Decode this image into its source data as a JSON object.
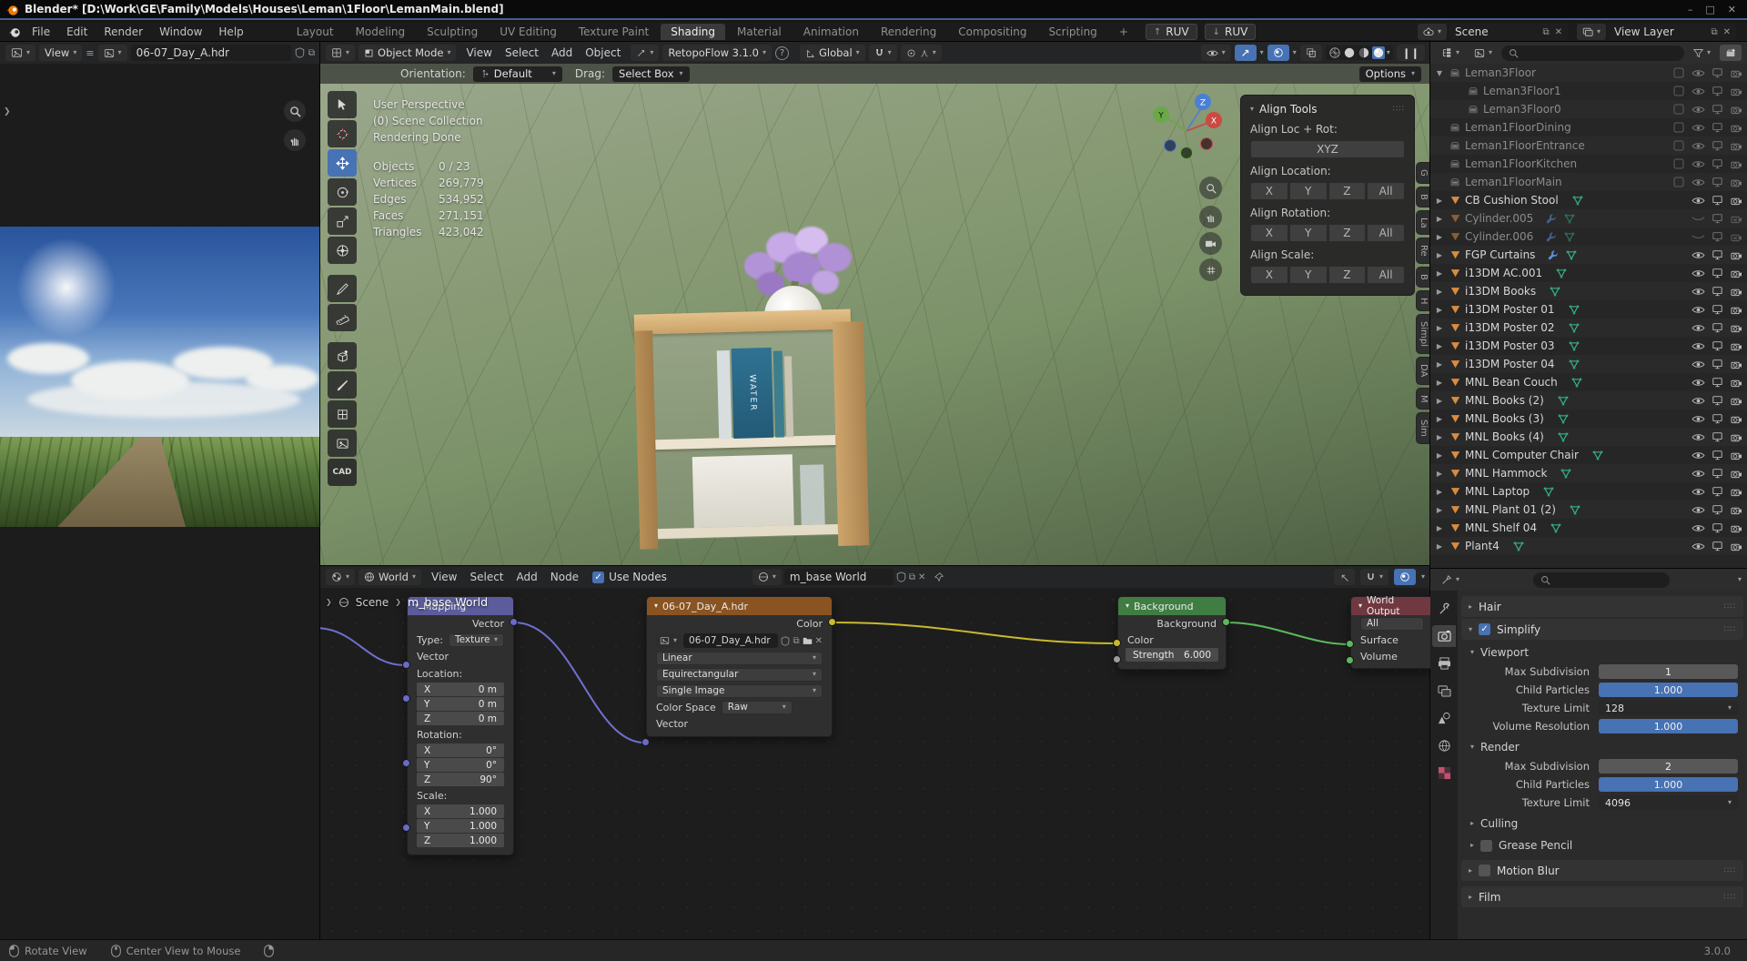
{
  "colors": {
    "accent": "#4772b3",
    "wire_yellow": "#c9b92e",
    "wire_green": "#5cb85c",
    "wire_purple": "#7070cf",
    "node_mapping": "#5c5c9c",
    "node_texture": "#8a5322",
    "node_background": "#3f7d43",
    "node_output": "#703841",
    "mesh_icon": "#d98c3f",
    "data_icon": "#3fbf8f",
    "wrench_icon": "#5b8fe0"
  },
  "titlebar": {
    "title": "Blender* [D:\\Work\\GE\\Family\\Models\\Houses\\Leman\\1Floor\\LemanMain.blend]",
    "controls": [
      "–",
      "□",
      "✕"
    ]
  },
  "menubar": {
    "menus": [
      "File",
      "Edit",
      "Render",
      "Window",
      "Help"
    ],
    "tabs": [
      "Layout",
      "Modeling",
      "Sculpting",
      "UV Editing",
      "Texture Paint",
      "Shading",
      "Material",
      "Animation",
      "Rendering",
      "Compositing",
      "Scripting"
    ],
    "active_tab": "Shading",
    "add_tab": "+",
    "ruv_buttons": [
      {
        "icon": "up",
        "label": "RUV"
      },
      {
        "icon": "down",
        "label": "RUV"
      }
    ],
    "scene_selector": "Scene",
    "view_layer_selector": "View Layer"
  },
  "image_editor": {
    "menu_view": "View",
    "image_name": "06-07_Day_A.hdr"
  },
  "viewport": {
    "header": {
      "mode": "Object Mode",
      "menus": [
        "View",
        "Select",
        "Add",
        "Object"
      ],
      "addon_dropdown": "RetopoFlow 3.1.0",
      "orientation": "Global"
    },
    "tool_settings": {
      "orientation_label": "Orientation:",
      "orientation_value": "Default",
      "drag_label": "Drag:",
      "drag_value": "Select Box",
      "options_label": "Options"
    },
    "overlay_lines": [
      "User Perspective",
      "(0) Scene Collection",
      "Rendering Done"
    ],
    "stats": [
      {
        "label": "Objects",
        "value": "0 / 23"
      },
      {
        "label": "Vertices",
        "value": "269,779"
      },
      {
        "label": "Edges",
        "value": "534,952"
      },
      {
        "label": "Faces",
        "value": "271,151"
      },
      {
        "label": "Triangles",
        "value": "423,042"
      }
    ],
    "toolbar_tools": [
      "select-box",
      "cursor",
      "move",
      "rotate",
      "scale",
      "transform",
      "annotate",
      "measure",
      "add-cube",
      "brush",
      "fill",
      "image"
    ],
    "toolbar_active": "move",
    "cad_label": "CAD",
    "axis_gizmo": {
      "x": "X",
      "y": "Y",
      "z": "Z"
    },
    "sidebar_tabs": [
      "G",
      "B",
      "La",
      "Re",
      "B",
      "H",
      "Simpl",
      "DA",
      "M",
      "Sim"
    ],
    "book_label": "WATER",
    "align_tools": {
      "title": "Align Tools",
      "loc_rot_label": "Align Loc + Rot:",
      "loc_rot_button": "XYZ",
      "groups": [
        {
          "label": "Align Location:",
          "buttons": [
            "X",
            "Y",
            "Z",
            "All"
          ]
        },
        {
          "label": "Align Rotation:",
          "buttons": [
            "X",
            "Y",
            "Z",
            "All"
          ]
        },
        {
          "label": "Align Scale:",
          "buttons": [
            "X",
            "Y",
            "Z",
            "All"
          ]
        }
      ]
    }
  },
  "outliner": {
    "rows": [
      {
        "label": "Leman3Floor",
        "icon": "collection",
        "indent": 0,
        "dim": true,
        "expand": "down",
        "right": "collection"
      },
      {
        "label": "Leman3Floor1",
        "icon": "collection",
        "indent": 1,
        "dim": true,
        "right": "collection"
      },
      {
        "label": "Leman3Floor0",
        "icon": "collection",
        "indent": 1,
        "dim": true,
        "right": "collection"
      },
      {
        "label": "Leman1FloorDining",
        "icon": "collection",
        "indent": 0,
        "dim": true,
        "right": "collection"
      },
      {
        "label": "Leman1FloorEntrance",
        "icon": "collection",
        "indent": 0,
        "dim": true,
        "right": "collection"
      },
      {
        "label": "Leman1FloorKitchen",
        "icon": "collection",
        "indent": 0,
        "dim": true,
        "right": "collection"
      },
      {
        "label": "Leman1FloorMain",
        "icon": "collection",
        "indent": 0,
        "dim": true,
        "right": "collection"
      },
      {
        "label": "CB Cushion Stool",
        "icon": "mesh",
        "indent": 0,
        "expand": "right",
        "data": true,
        "right": "object"
      },
      {
        "label": "Cylinder.005",
        "icon": "mesh",
        "indent": 0,
        "dim": true,
        "expand": "right",
        "wrench": true,
        "data": true,
        "right": "object-hidden"
      },
      {
        "label": "Cylinder.006",
        "icon": "mesh",
        "indent": 0,
        "dim": true,
        "expand": "right",
        "wrench": true,
        "data": true,
        "right": "object-hidden"
      },
      {
        "label": "FGP Curtains",
        "icon": "mesh",
        "indent": 0,
        "expand": "right",
        "wrench": true,
        "data": true,
        "right": "object"
      },
      {
        "label": "i13DM AC.001",
        "icon": "mesh",
        "indent": 0,
        "expand": "right",
        "data": true,
        "right": "object"
      },
      {
        "label": "i13DM Books",
        "icon": "mesh",
        "indent": 0,
        "expand": "right",
        "data": true,
        "right": "object"
      },
      {
        "label": "i13DM Poster 01",
        "icon": "mesh",
        "indent": 0,
        "expand": "right",
        "data": true,
        "right": "object"
      },
      {
        "label": "i13DM Poster 02",
        "icon": "mesh",
        "indent": 0,
        "expand": "right",
        "data": true,
        "right": "object"
      },
      {
        "label": "i13DM Poster 03",
        "icon": "mesh",
        "indent": 0,
        "expand": "right",
        "data": true,
        "right": "object"
      },
      {
        "label": "i13DM Poster 04",
        "icon": "mesh",
        "indent": 0,
        "expand": "right",
        "data": true,
        "right": "object"
      },
      {
        "label": "MNL Bean Couch",
        "icon": "mesh",
        "indent": 0,
        "expand": "right",
        "data": true,
        "right": "object"
      },
      {
        "label": "MNL Books (2)",
        "icon": "mesh",
        "indent": 0,
        "expand": "right",
        "data": true,
        "right": "object"
      },
      {
        "label": "MNL Books (3)",
        "icon": "mesh",
        "indent": 0,
        "expand": "right",
        "data": true,
        "right": "object"
      },
      {
        "label": "MNL Books (4)",
        "icon": "mesh",
        "indent": 0,
        "expand": "right",
        "data": true,
        "right": "object"
      },
      {
        "label": "MNL Computer Chair",
        "icon": "mesh",
        "indent": 0,
        "expand": "right",
        "data": true,
        "right": "object"
      },
      {
        "label": "MNL Hammock",
        "icon": "mesh",
        "indent": 0,
        "expand": "right",
        "data": true,
        "right": "object"
      },
      {
        "label": "MNL Laptop",
        "icon": "mesh",
        "indent": 0,
        "expand": "right",
        "data": true,
        "right": "object"
      },
      {
        "label": "MNL Plant 01 (2)",
        "icon": "mesh",
        "indent": 0,
        "expand": "right",
        "data": true,
        "right": "object"
      },
      {
        "label": "MNL Shelf 04",
        "icon": "mesh",
        "indent": 0,
        "expand": "right",
        "data": true,
        "right": "object"
      },
      {
        "label": "Plant4",
        "icon": "mesh",
        "indent": 0,
        "expand": "right",
        "data": true,
        "right": "object"
      }
    ]
  },
  "node_editor": {
    "header": {
      "shader_type": "World",
      "menus": [
        "View",
        "Select",
        "Add",
        "Node"
      ],
      "use_nodes_label": "Use Nodes",
      "datablock": "m_base World"
    },
    "breadcrumb": {
      "scene": "Scene",
      "path": "m_base World"
    },
    "mapping_node": {
      "title": "Mapping",
      "output": "Vector",
      "type_label": "Type:",
      "type_value": "Texture",
      "input": "Vector",
      "groups": [
        {
          "label": "Location:",
          "rows": [
            {
              "axis": "X",
              "value": "0 m"
            },
            {
              "axis": "Y",
              "value": "0 m"
            },
            {
              "axis": "Z",
              "value": "0 m"
            }
          ]
        },
        {
          "label": "Rotation:",
          "rows": [
            {
              "axis": "X",
              "value": "0°"
            },
            {
              "axis": "Y",
              "value": "0°"
            },
            {
              "axis": "Z",
              "value": "90°"
            }
          ]
        },
        {
          "label": "Scale:",
          "rows": [
            {
              "axis": "X",
              "value": "1.000"
            },
            {
              "axis": "Y",
              "value": "1.000"
            },
            {
              "axis": "Z",
              "value": "1.000"
            }
          ]
        }
      ]
    },
    "texture_node": {
      "title": "06-07_Day_A.hdr",
      "output": "Color",
      "image_name": "06-07_Day_A.hdr",
      "interpolation": "Linear",
      "projection": "Equirectangular",
      "source": "Single Image",
      "colorspace_label": "Color Space",
      "colorspace_value": "Raw",
      "input": "Vector"
    },
    "background_node": {
      "title": "Background",
      "output": "Background",
      "input": "Color",
      "strength_label": "Strength",
      "strength_value": "6.000"
    },
    "output_node": {
      "title": "World Output",
      "target": "All",
      "inputs": [
        "Surface",
        "Volume"
      ]
    }
  },
  "properties": {
    "nav_tabs": [
      {
        "name": "tool"
      },
      {
        "name": "render",
        "active": true
      },
      {
        "name": "output"
      },
      {
        "name": "view-layer"
      },
      {
        "name": "scene"
      },
      {
        "name": "world"
      },
      {
        "name": "texture"
      }
    ],
    "hair_panel": "Hair",
    "simplify_panel": "Simplify",
    "viewport_section": {
      "title": "Viewport",
      "rows": [
        {
          "label": "Max Subdivision",
          "value": "1",
          "style": "slider"
        },
        {
          "label": "Child Particles",
          "value": "1.000",
          "style": "blue"
        },
        {
          "label": "Texture Limit",
          "value": "128",
          "style": "dropdown"
        },
        {
          "label": "Volume Resolution",
          "value": "1.000",
          "style": "blue"
        }
      ]
    },
    "render_section": {
      "title": "Render",
      "rows": [
        {
          "label": "Max Subdivision",
          "value": "2",
          "style": "slider"
        },
        {
          "label": "Child Particles",
          "value": "1.000",
          "style": "blue"
        },
        {
          "label": "Texture Limit",
          "value": "4096",
          "style": "dropdown"
        }
      ]
    },
    "sub_panels": [
      {
        "title": "Culling",
        "checkbox": false
      },
      {
        "title": "Grease Pencil",
        "checkbox": true
      }
    ],
    "bottom_panels": [
      {
        "title": "Motion Blur",
        "checkbox": true
      },
      {
        "title": "Film",
        "checkbox": false
      }
    ]
  },
  "statusbar": {
    "hints": [
      {
        "icon": "mouse-left",
        "label": "Rotate View"
      },
      {
        "icon": "mouse-middle",
        "label": "Center View to Mouse"
      },
      {
        "icon": "mouse-right",
        "label": ""
      }
    ],
    "version": "3.0.0"
  }
}
